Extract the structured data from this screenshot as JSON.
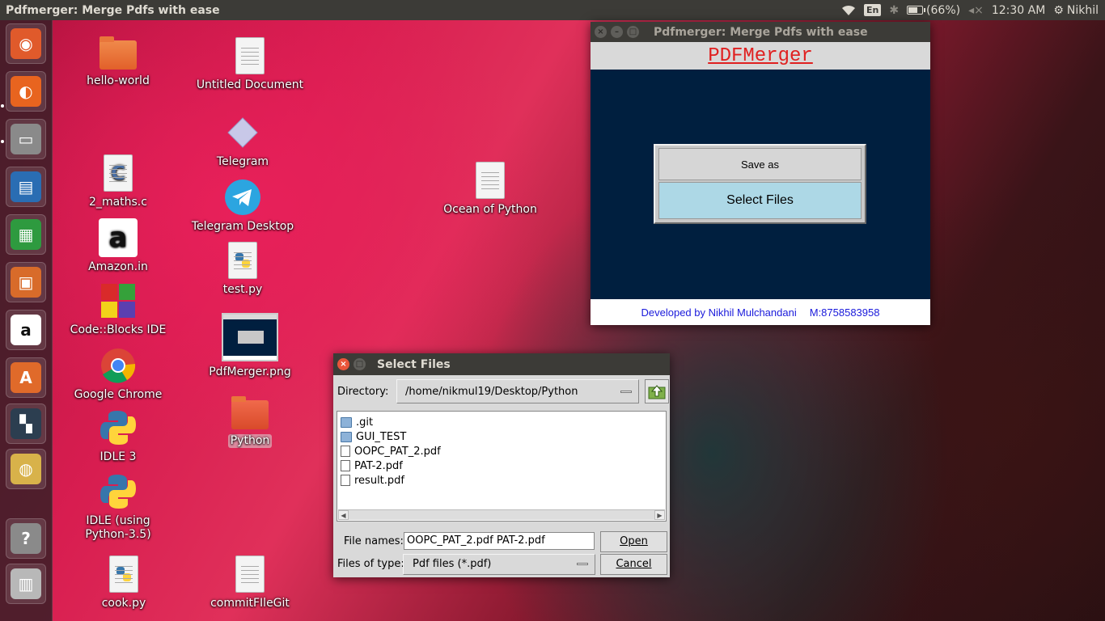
{
  "panel": {
    "window_title": "Pdfmerger: Merge Pdfs with ease",
    "keyboard": "En",
    "battery": "(66%)",
    "time": "12:30 AM",
    "user": "Nikhil"
  },
  "launcher": {
    "items": [
      {
        "name": "ubuntu-dash",
        "glyph": "◉",
        "color": "#e05a2b"
      },
      {
        "name": "firefox",
        "glyph": "◐",
        "color": "#e8641f"
      },
      {
        "name": "files",
        "glyph": "▭",
        "color": "#8a8a8a"
      },
      {
        "name": "writer",
        "glyph": "▤",
        "color": "#2a6db3"
      },
      {
        "name": "calc",
        "glyph": "▦",
        "color": "#2e9a3f"
      },
      {
        "name": "impress",
        "glyph": "▣",
        "color": "#d86b2a"
      },
      {
        "name": "amazon",
        "glyph": "a",
        "color": "#ffffff"
      },
      {
        "name": "software-center",
        "glyph": "A",
        "color": "#e06a2a"
      },
      {
        "name": "workspaces",
        "glyph": "▚",
        "color": "#2c3e50"
      },
      {
        "name": "chrome",
        "glyph": "◍",
        "color": "#d8b24a"
      },
      {
        "name": "help",
        "glyph": "?",
        "color": "#8a8a8a"
      },
      {
        "name": "trash",
        "glyph": "▥",
        "color": "#b8b8b8"
      }
    ]
  },
  "desktop": {
    "icons": [
      {
        "label": "hello-world",
        "type": "folder"
      },
      {
        "label": "Untitled Document",
        "type": "doc"
      },
      {
        "label": "Telegram",
        "type": "telegram-diamond"
      },
      {
        "label": "2_maths.c",
        "type": "c-source"
      },
      {
        "label": "Telegram Desktop",
        "type": "telegram"
      },
      {
        "label": "Ocean of Python",
        "type": "doc"
      },
      {
        "label": "Amazon.in",
        "type": "amazon"
      },
      {
        "label": "test.py",
        "type": "python-file"
      },
      {
        "label": "Code::Blocks IDE",
        "type": "codeblocks"
      },
      {
        "label": "Google Chrome",
        "type": "chrome"
      },
      {
        "label": "PdfMerger.png",
        "type": "image"
      },
      {
        "label": "IDLE 3",
        "type": "python"
      },
      {
        "label": "Python",
        "type": "folder"
      },
      {
        "label": "IDLE (using Python-3.5)",
        "type": "python"
      },
      {
        "label": "cook.py",
        "type": "python-file"
      },
      {
        "label": "commitFIleGit",
        "type": "doc"
      }
    ]
  },
  "pdfmerger": {
    "title": "Pdfmerger: Merge Pdfs with ease",
    "heading": "PDFMerger",
    "save_label": "Save as",
    "select_label": "Select Files",
    "developer": "Developed by Nikhil Mulchandani",
    "mobile": "M:8758583958"
  },
  "dialog": {
    "title": "Select Files",
    "directory_label": "Directory:",
    "directory": "/home/nikmul19/Desktop/Python",
    "files": [
      {
        "name": ".git",
        "kind": "dir"
      },
      {
        "name": "GUI_TEST",
        "kind": "dir"
      },
      {
        "name": "OOPC_PAT_2.pdf",
        "kind": "file"
      },
      {
        "name": "PAT-2.pdf",
        "kind": "file"
      },
      {
        "name": "result.pdf",
        "kind": "file"
      }
    ],
    "file_names_label": "File names:",
    "file_names_value": "OOPC_PAT_2.pdf PAT-2.pdf",
    "files_of_type_label": "Files of type:",
    "file_type": "Pdf files (*.pdf)",
    "open_label": "Open",
    "cancel_label": "Cancel"
  }
}
